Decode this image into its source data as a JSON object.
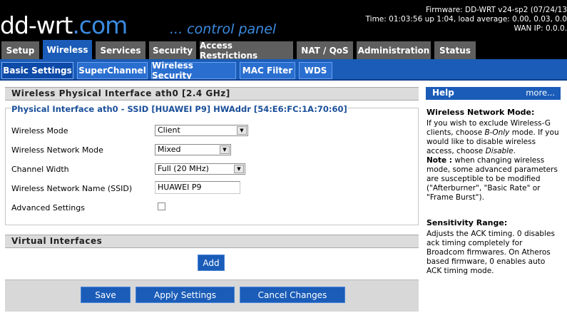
{
  "header": {
    "logo_main": "dd-wrt",
    "logo_suffix": ".com",
    "tagline": "... control panel",
    "firmware": "Firmware: DD-WRT v24-sp2 (07/24/13",
    "time": "Time: 01:03:56 up 1:04, load average: 0.00, 0.03, 0.0",
    "wan_ip": "WAN IP: 0.0.0."
  },
  "nav": {
    "tabs": [
      {
        "label": "Setup"
      },
      {
        "label": "Wireless"
      },
      {
        "label": "Services"
      },
      {
        "label": "Security"
      },
      {
        "label": "Access Restrictions"
      },
      {
        "label": "NAT / QoS"
      },
      {
        "label": "Administration"
      },
      {
        "label": "Status"
      }
    ]
  },
  "subnav": {
    "tabs": [
      {
        "label": "Basic Settings"
      },
      {
        "label": "SuperChannel"
      },
      {
        "label": "Wireless Security"
      },
      {
        "label": "MAC Filter"
      },
      {
        "label": "WDS"
      }
    ]
  },
  "main": {
    "section1_title": "Wireless Physical Interface ath0 [2.4 GHz]",
    "fieldset_legend": "Physical Interface ath0 - SSID [HUAWEI P9] HWAddr [54:E6:FC:1A:70:60]",
    "fields": {
      "wireless_mode": {
        "label": "Wireless Mode",
        "value": "Client"
      },
      "network_mode": {
        "label": "Wireless Network Mode",
        "value": "Mixed"
      },
      "channel_width": {
        "label": "Channel Width",
        "value": "Full (20 MHz)"
      },
      "ssid": {
        "label": "Wireless Network Name (SSID)",
        "value": "HUAWEI P9"
      },
      "advanced": {
        "label": "Advanced Settings",
        "checked": false
      }
    },
    "section2_title": "Virtual Interfaces",
    "add_label": "Add",
    "save_label": "Save",
    "apply_label": "Apply Settings",
    "cancel_label": "Cancel Changes"
  },
  "help": {
    "title": "Help",
    "more": "more...",
    "t1": "Wireless Network Mode:",
    "p1a": "If you wish to exclude Wireless-G clients, choose ",
    "p1b": "B-Only",
    "p1c": " mode. If you would like to disable wireless access, choose ",
    "p1d": "Disable",
    "p1e": ".",
    "note_label": "Note :",
    "note_text": " when changing wireless mode, some advanced parameters are susceptible to be modified (\"Afterburner\", \"Basic Rate\" or \"Frame Burst\").",
    "t2": "Sensitivity Range:",
    "p2": "Adjusts the ACK timing. 0 disables ack timing completely for Broadcom firmwares. On Atheros based firmware, 0 enables auto ACK timing mode."
  },
  "colors": {
    "accent_blue": "#1a5cb8",
    "tab_gray": "#5f5f5f",
    "logo_blue": "#3b8be0"
  }
}
